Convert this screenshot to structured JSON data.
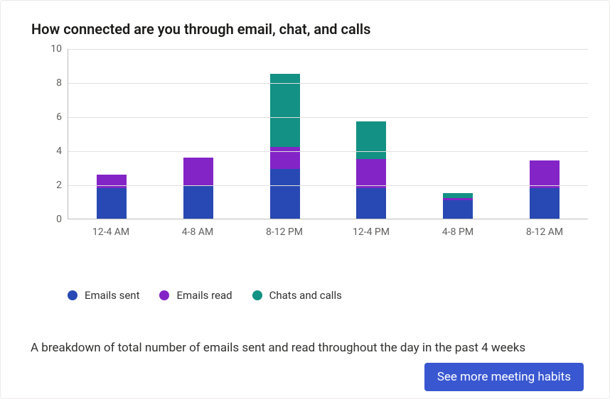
{
  "title": "How connected are you through email, chat, and calls",
  "description": "A breakdown of total number of emails sent and read throughout the day in the past 4 weeks",
  "cta_label": "See more meeting habits",
  "legend": {
    "sent": "Emails sent",
    "read": "Emails read",
    "chats": "Chats and calls"
  },
  "colors": {
    "sent": "#2849b3",
    "read": "#8324c7",
    "chats": "#129184"
  },
  "chart_data": {
    "type": "bar",
    "stacked": true,
    "ylabel": "",
    "xlabel": "",
    "ylim": [
      0,
      10
    ],
    "yticks": [
      0,
      2,
      4,
      6,
      8,
      10
    ],
    "categories": [
      "12-4 AM",
      "4-8 AM",
      "8-12 PM",
      "12-4 PM",
      "4-8 PM",
      "8-12 AM"
    ],
    "series": [
      {
        "name": "Emails sent",
        "values": [
          1.8,
          1.9,
          2.9,
          1.8,
          1.1,
          1.8
        ]
      },
      {
        "name": "Emails read",
        "values": [
          0.8,
          1.7,
          1.3,
          1.7,
          0.1,
          1.6
        ]
      },
      {
        "name": "Chats and calls",
        "values": [
          0.0,
          0.0,
          4.3,
          2.2,
          0.3,
          0.0
        ]
      }
    ]
  }
}
